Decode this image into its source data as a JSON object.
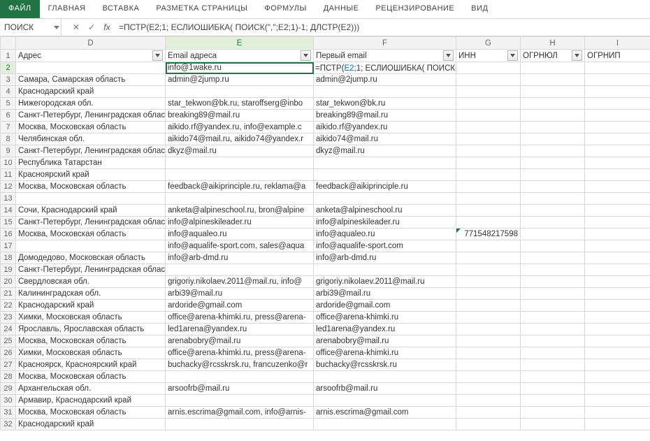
{
  "ribbon": {
    "file": "ФАЙЛ",
    "tabs": [
      "ГЛАВНАЯ",
      "ВСТАВКА",
      "РАЗМЕТКА СТРАНИЦЫ",
      "ФОРМУЛЫ",
      "ДАННЫЕ",
      "РЕЦЕНЗИРОВАНИЕ",
      "ВИД"
    ]
  },
  "namebox": "ПОИСК",
  "fx_icons": {
    "cancel": "✕",
    "confirm": "✓",
    "fx": "fx"
  },
  "formula_bar": "=ПСТР(E2;1; ЕСЛИОШИБКА( ПОИСК(\",\";E2;1)-1; ДЛСТР(E2)))",
  "columns": [
    "D",
    "E",
    "F",
    "G",
    "H",
    "I"
  ],
  "headers": {
    "D": "Адрес",
    "E": "Email адреса",
    "F": "Первый email",
    "G": "ИНН",
    "H": "ОГРНЮЛ",
    "I": "ОГРНИП"
  },
  "active_cell_value": "info@1wake.ru",
  "f2_formula_tokens": [
    {
      "t": "=ПСТР(",
      "c": "fn"
    },
    {
      "t": "E2",
      "c": "ref"
    },
    {
      "t": ";1; ЕСЛИОШИБКА( ПОИСК(\",\";",
      "c": "fn"
    },
    {
      "t": "E2",
      "c": "ref"
    },
    {
      "t": ";1)-1; ДЛСТР(",
      "c": "fn"
    },
    {
      "t": "E2",
      "c": "ref"
    },
    {
      "t": ")))",
      "c": "fn"
    }
  ],
  "rows": [
    {
      "n": 2,
      "D": "",
      "E": "info@1wake.ru",
      "F": "__FORMULA__",
      "G": "",
      "H": "",
      "I": ""
    },
    {
      "n": 3,
      "D": "Самара, Самарская область",
      "E": "admin@2jump.ru",
      "F": "admin@2jump.ru",
      "G": "",
      "H": "",
      "I": ""
    },
    {
      "n": 4,
      "D": "Краснодарский край",
      "E": "",
      "F": "",
      "G": "",
      "H": "",
      "I": ""
    },
    {
      "n": 5,
      "D": "Нижегородская обл.",
      "E": "star_tekwon@bk.ru, staroffserg@inbo",
      "F": "star_tekwon@bk.ru",
      "G": "",
      "H": "",
      "I": ""
    },
    {
      "n": 6,
      "D": "Санкт-Петербург, Ленинградская облас",
      "E": "breaking89@mail.ru",
      "F": "breaking89@mail.ru",
      "G": "",
      "H": "",
      "I": ""
    },
    {
      "n": 7,
      "D": "Москва, Московская область",
      "E": "aikido.rf@yandex.ru, info@example.c",
      "F": "aikido.rf@yandex.ru",
      "G": "",
      "H": "",
      "I": ""
    },
    {
      "n": 8,
      "D": "Челябинская обл.",
      "E": "aikido74@mail.ru, aikido74@yandex.r",
      "F": "aikido74@mail.ru",
      "G": "",
      "H": "",
      "I": ""
    },
    {
      "n": 9,
      "D": "Санкт-Петербург, Ленинградская облас",
      "E": "dkyz@mail.ru",
      "F": "dkyz@mail.ru",
      "G": "",
      "H": "",
      "I": ""
    },
    {
      "n": 10,
      "D": "Республика Татарстан",
      "E": "",
      "F": "",
      "G": "",
      "H": "",
      "I": ""
    },
    {
      "n": 11,
      "D": "Красноярский край",
      "E": "",
      "F": "",
      "G": "",
      "H": "",
      "I": ""
    },
    {
      "n": 12,
      "D": "Москва, Московская область",
      "E": "feedback@aikiprinciple.ru, reklama@a",
      "F": "feedback@aikiprinciple.ru",
      "G": "",
      "H": "",
      "I": ""
    },
    {
      "n": 13,
      "D": "",
      "E": "",
      "F": "",
      "G": "",
      "H": "",
      "I": ""
    },
    {
      "n": 14,
      "D": "Сочи, Краснодарский край",
      "E": "anketa@alpineschool.ru, bron@alpine",
      "F": "anketa@alpineschool.ru",
      "G": "",
      "H": "",
      "I": ""
    },
    {
      "n": 15,
      "D": "Санкт-Петербург, Ленинградская облас",
      "E": "info@alpineskileader.ru",
      "F": "info@alpineskileader.ru",
      "G": "",
      "H": "",
      "I": ""
    },
    {
      "n": 16,
      "D": "Москва, Московская область",
      "E": "info@aqualeo.ru",
      "F": "info@aqualeo.ru",
      "G": "771548217598",
      "Gflag": true,
      "H": "",
      "I": ""
    },
    {
      "n": 17,
      "D": "",
      "E": "info@aqualife-sport.com, sales@aqua",
      "F": "info@aqualife-sport.com",
      "G": "",
      "H": "",
      "I": ""
    },
    {
      "n": 18,
      "D": "Домодедово, Московская область",
      "E": "info@arb-dmd.ru",
      "F": "info@arb-dmd.ru",
      "G": "",
      "H": "",
      "I": ""
    },
    {
      "n": 19,
      "D": "Санкт-Петербург, Ленинградская область",
      "E": "",
      "F": "",
      "G": "",
      "H": "",
      "I": ""
    },
    {
      "n": 20,
      "D": "Свердловская обл.",
      "E": "grigoriy.nikolaev.2011@mail.ru, info@",
      "F": "grigoriy.nikolaev.2011@mail.ru",
      "G": "",
      "H": "",
      "I": ""
    },
    {
      "n": 21,
      "D": "Калининградская обл.",
      "E": "arbi39@mail.ru",
      "F": "arbi39@mail.ru",
      "G": "",
      "H": "",
      "I": ""
    },
    {
      "n": 22,
      "D": "Краснодарский край",
      "E": "ardoride@gmail.com",
      "F": "ardoride@gmail.com",
      "G": "",
      "H": "",
      "I": ""
    },
    {
      "n": 23,
      "D": "Химки, Московская область",
      "E": "office@arena-khimki.ru, press@arena-",
      "F": "office@arena-khimki.ru",
      "G": "",
      "H": "",
      "I": ""
    },
    {
      "n": 24,
      "D": "Ярославль, Ярославская область",
      "E": "led1arena@yandex.ru",
      "F": "led1arena@yandex.ru",
      "G": "",
      "H": "",
      "I": ""
    },
    {
      "n": 25,
      "D": "Москва, Московская область",
      "E": "arenabobry@mail.ru",
      "F": "arenabobry@mail.ru",
      "G": "",
      "H": "",
      "I": ""
    },
    {
      "n": 26,
      "D": "Химки, Московская область",
      "E": "office@arena-khimki.ru, press@arena-",
      "F": "office@arena-khimki.ru",
      "G": "",
      "H": "",
      "I": ""
    },
    {
      "n": 27,
      "D": "Красноярск, Красноярский край",
      "E": "buchacky@rcsskrsk.ru, francuzenko@r",
      "F": "buchacky@rcsskrsk.ru",
      "G": "",
      "H": "",
      "I": ""
    },
    {
      "n": 28,
      "D": "Москва, Московская область",
      "E": "",
      "F": "",
      "G": "",
      "H": "",
      "I": ""
    },
    {
      "n": 29,
      "D": "Архангельская обл.",
      "E": "arsoofrb@mail.ru",
      "F": "arsoofrb@mail.ru",
      "G": "",
      "H": "",
      "I": ""
    },
    {
      "n": 30,
      "D": "Армавир, Краснодарский край",
      "E": "",
      "F": "",
      "G": "",
      "H": "",
      "I": ""
    },
    {
      "n": 31,
      "D": "Москва, Московская область",
      "E": "arnis.escrima@gmail.com, info@arnis-",
      "F": "arnis.escrima@gmail.com",
      "G": "",
      "H": "",
      "I": ""
    },
    {
      "n": 32,
      "D": "Краснодарский край",
      "E": "",
      "F": "",
      "G": "",
      "H": "",
      "I": ""
    }
  ]
}
